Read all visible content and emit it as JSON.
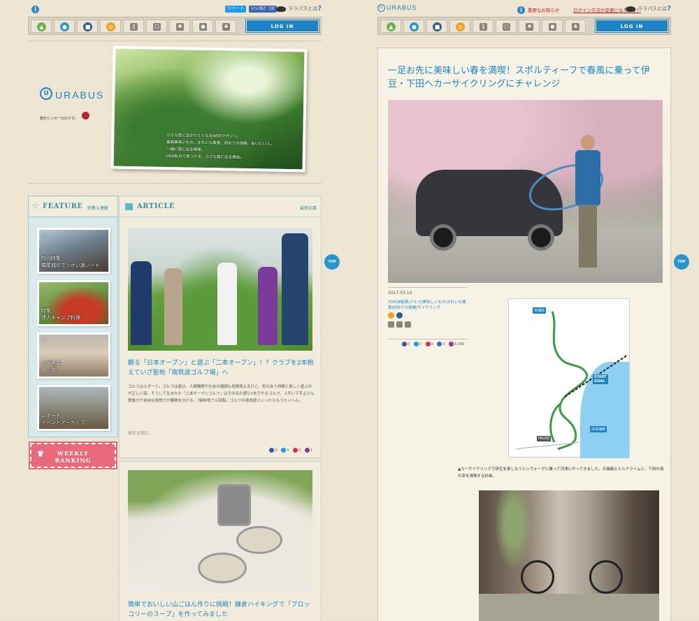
{
  "left": {
    "topbar": {
      "tweet": "ツイート",
      "like": "いいね！",
      "like_count": "10",
      "lalapass": "ララパスとは"
    },
    "nav": {
      "login": "LOG IN"
    },
    "logo": {
      "u": "U",
      "text": "URABUS",
      "sub": "旅がジンセーなのです。"
    },
    "hero": {
      "line1": "小さな旅に出かけたくなるWEBマガジン。",
      "line2": "最高美味いもの、きれいな風景、初めての体験、会いたい人。",
      "line3": "一緒に旅に出る時間。",
      "line4": "URABUSで見つける、小さな旅に出る理由。"
    },
    "feature": {
      "title": "FEATURE",
      "sub": "特集＆連載",
      "tiles": [
        {
          "l1": "特別特集",
          "l2": "糧尾城のでっかい旅ノート"
        },
        {
          "l1": "特集",
          "l2": "達人キャンプ料理"
        },
        {
          "l1": "人気連載",
          "l2": "食べ旅!"
        },
        {
          "l1": "レポート",
          "l2": "イベントアーカイブ"
        }
      ]
    },
    "weekly": {
      "l1": "WEEKLY",
      "l2": "RANKING"
    },
    "article": {
      "title": "ARTICLE",
      "more": "最新記事",
      "items": [
        {
          "heading": "観る「日本オープン」と遊ぶ「二本オープン」！？クラブを2本抱えていざ聖地「南筑波ゴルフ場」へ",
          "body": "ゴルフはスポーツ。ゴルフは遊び。人間模様や社会の縮図も垣間見えるけど、気の合う仲間と楽しく遊ぶのが正しい道。そうして生まれた「二本オープンゴルフ」はその名の通り2本でやるゴルフ。上手い下手よりも想像力や自由な発想力が勝敗を分ける、「脳味噌フル回転」ゴルフの達成感といったらもうたいへん。",
          "more": "続きを読む",
          "shares": [
            "0",
            "0",
            "0",
            "1"
          ]
        },
        {
          "heading": "簡単でおいしい山ごはん作りに挑戦！鎌倉ハイキングで「ブロッコリーのスープ」を作ってみました"
        }
      ]
    },
    "top": "TOP"
  },
  "right": {
    "logo": "URABUS",
    "notice1": "重要なお知らせ",
    "notice2": "ログイン方法が変更になります！",
    "lalapass": "ララパスとは",
    "nav": {
      "login": "LOG IN"
    },
    "title": "一足お先に美味しい春を満喫！スポルティーフで春風に乗って伊豆・下田へカーサイクリングにチャレンジ",
    "date": "2017.03.14",
    "tags": "TOP|自転車|クルマ|美味しいもの|きれいな風景|初めての体験|サイクリング",
    "shares": [
      "0",
      "0",
      "0",
      "0",
      "6,069"
    ],
    "map": {
      "start": "START",
      "goal": "GOAL",
      "amagi": "天城峠",
      "shirahama": "白浜海岸",
      "pause": "PAUSE"
    },
    "caption": "▲カーサイクリングで伊豆を楽しもうとレヴォーグに乗って河津にやってきました。天城越えヒルクライムと、下田の海の幸を満喫する計画。",
    "top": "TOP"
  },
  "icons": {
    "nav": [
      "mountain-icon",
      "drop-icon",
      "car-icon",
      "bike-icon",
      "fork-icon",
      "frame-icon",
      "sun-icon",
      "person-icon",
      "people-icon"
    ],
    "colors": {
      "mountain": "#6cb24a",
      "drop": "#2a95cd",
      "car": "#2d5f8f",
      "bike": "#f0a020",
      "accent": "#1c84c6"
    }
  }
}
